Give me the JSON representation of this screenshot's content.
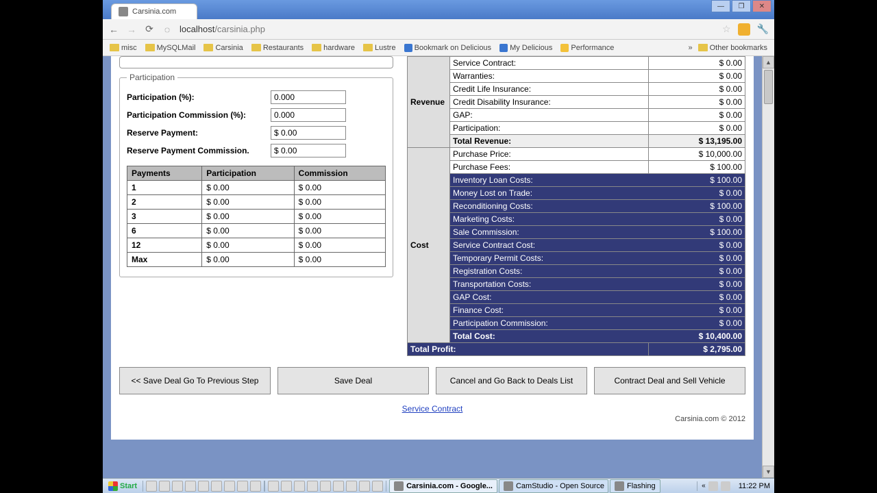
{
  "browser": {
    "tab_title": "Carsinia.com",
    "url_host": "localhost",
    "url_path": "/carsinia.php"
  },
  "bookmarks": {
    "items": [
      "misc",
      "MySQLMail",
      "Carsinia",
      "Restaurants",
      "hardware",
      "Lustre"
    ],
    "delicious_bookmark": "Bookmark on Delicious",
    "my_delicious": "My Delicious",
    "performance": "Performance",
    "other": "Other bookmarks"
  },
  "participation": {
    "legend": "Participation",
    "pct_label": "Participation (%):",
    "pct_value": "0.000",
    "comm_label": "Participation Commission (%):",
    "comm_value": "0.000",
    "reserve_label": "Reserve Payment:",
    "reserve_value": "$ 0.00",
    "reserve_comm_label": "Reserve Payment Commission.",
    "reserve_comm_value": "$ 0.00"
  },
  "payments_table": {
    "headers": [
      "Payments",
      "Participation",
      "Commission"
    ],
    "rows": [
      {
        "n": "1",
        "p": "$ 0.00",
        "c": "$ 0.00"
      },
      {
        "n": "2",
        "p": "$ 0.00",
        "c": "$ 0.00"
      },
      {
        "n": "3",
        "p": "$ 0.00",
        "c": "$ 0.00"
      },
      {
        "n": "6",
        "p": "$ 0.00",
        "c": "$ 0.00"
      },
      {
        "n": "12",
        "p": "$ 0.00",
        "c": "$ 0.00"
      },
      {
        "n": "Max",
        "p": "$ 0.00",
        "c": "$ 0.00"
      }
    ]
  },
  "finance": {
    "revenue_label": "Revenue",
    "cost_label": "Cost",
    "revenue": [
      {
        "l": "Service Contract:",
        "v": "$ 0.00"
      },
      {
        "l": "Warranties:",
        "v": "$ 0.00"
      },
      {
        "l": "Credit Life Insurance:",
        "v": "$ 0.00"
      },
      {
        "l": "Credit Disability Insurance:",
        "v": "$ 0.00"
      },
      {
        "l": "GAP:",
        "v": "$ 0.00"
      },
      {
        "l": "Participation:",
        "v": "$ 0.00"
      }
    ],
    "total_revenue": {
      "l": "Total Revenue:",
      "v": "$ 13,195.00"
    },
    "cost_plain": [
      {
        "l": "Purchase Price:",
        "v": "$ 10,000.00"
      },
      {
        "l": "Purchase Fees:",
        "v": "$ 100.00"
      }
    ],
    "cost_hl": [
      {
        "l": "Inventory Loan Costs:",
        "v": "$ 100.00"
      },
      {
        "l": "Money Lost on Trade:",
        "v": "$ 0.00"
      },
      {
        "l": "Reconditioning Costs:",
        "v": "$ 100.00"
      },
      {
        "l": "Marketing Costs:",
        "v": "$ 0.00"
      },
      {
        "l": "Sale Commission:",
        "v": "$ 100.00"
      },
      {
        "l": "Service Contract Cost:",
        "v": "$ 0.00"
      },
      {
        "l": "Temporary Permit Costs:",
        "v": "$ 0.00"
      },
      {
        "l": "Registration Costs:",
        "v": "$ 0.00"
      },
      {
        "l": "Transportation Costs:",
        "v": "$ 0.00"
      },
      {
        "l": "GAP Cost:",
        "v": "$ 0.00"
      },
      {
        "l": "Finance Cost:",
        "v": "$ 0.00"
      },
      {
        "l": "Participation Commission:",
        "v": "$ 0.00"
      }
    ],
    "total_cost": {
      "l": "Total Cost:",
      "v": "$ 10,400.00"
    },
    "total_profit": {
      "l": "Total Profit:",
      "v": "$ 2,795.00"
    }
  },
  "buttons": {
    "prev": "<< Save Deal Go To Previous Step",
    "save": "Save Deal",
    "cancel": "Cancel and Go Back to Deals List",
    "contract": "Contract Deal and Sell Vehicle"
  },
  "footer": {
    "link": "Service Contract",
    "copyright": "Carsinia.com © 2012"
  },
  "taskbar": {
    "start": "Start",
    "tasks": [
      {
        "t": "Carsinia.com - Google...",
        "active": true
      },
      {
        "t": "CamStudio - Open Source",
        "active": false
      },
      {
        "t": "Flashing",
        "active": false
      }
    ],
    "clock": "11:22 PM"
  }
}
